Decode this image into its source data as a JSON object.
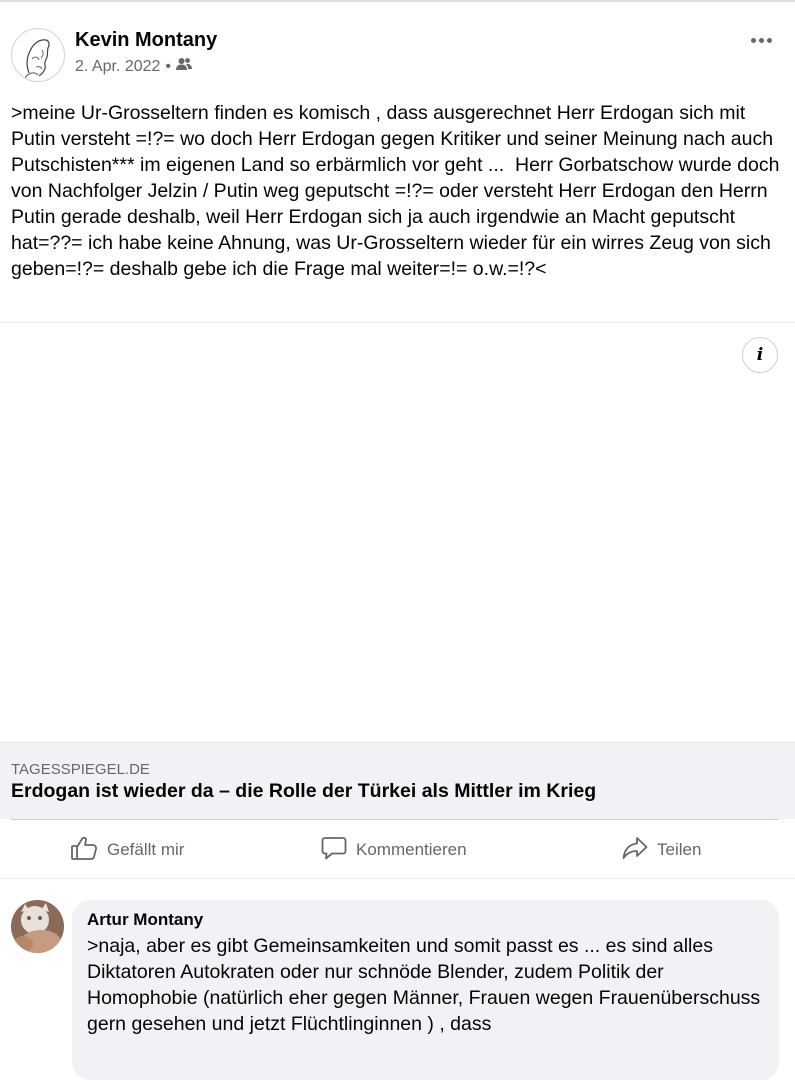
{
  "post": {
    "author": "Kevin Montany",
    "date": "2. Apr. 2022",
    "separator": "•",
    "audience_icon": "friends-icon",
    "text": ">meine Ur-Grosseltern finden es komisch , dass ausgerechnet Herr Erdogan sich mit Putin versteht =!?= wo doch Herr Erdogan gegen Kritiker und seiner Meinung nach auch Putschisten*** im eigenen Land so erbärmlich vor geht ...  Herr Gorbatschow wurde doch von Nachfolger Jelzin / Putin weg geputscht =!?= oder versteht Herr Erdogan den Herrn Putin gerade deshalb, weil Herr Erdogan sich ja auch irgendwie an Macht geputscht hat=??= ich habe keine Ahnung, was Ur-Grosseltern wieder für ein wirres Zeug von sich geben=!?= deshalb gebe ich die Frage mal weiter=!= o.w.=!?<"
  },
  "link_preview": {
    "domain": "TAGESSPIEGEL.DE",
    "title": "Erdogan ist wieder da – die Rolle der Türkei als Mittler im Krieg",
    "info_icon": "info-icon"
  },
  "actions": {
    "like": "Gefällt mir",
    "comment": "Kommentieren",
    "share": "Teilen"
  },
  "comment": {
    "author": "Artur Montany",
    "text": ">naja, aber es gibt Gemeinsamkeiten und somit passt es ... es sind alles Diktatoren Autokraten oder nur schnöde Blender, zudem Politik der Homophobie (natürlich eher gegen Männer, Frauen wegen Frauenüberschuss gern gesehen und jetzt Flüchtlinginnen ) , dass"
  },
  "colors": {
    "text": "#050505",
    "secondary": "#65676b",
    "link_bg": "#f0f2f5"
  }
}
